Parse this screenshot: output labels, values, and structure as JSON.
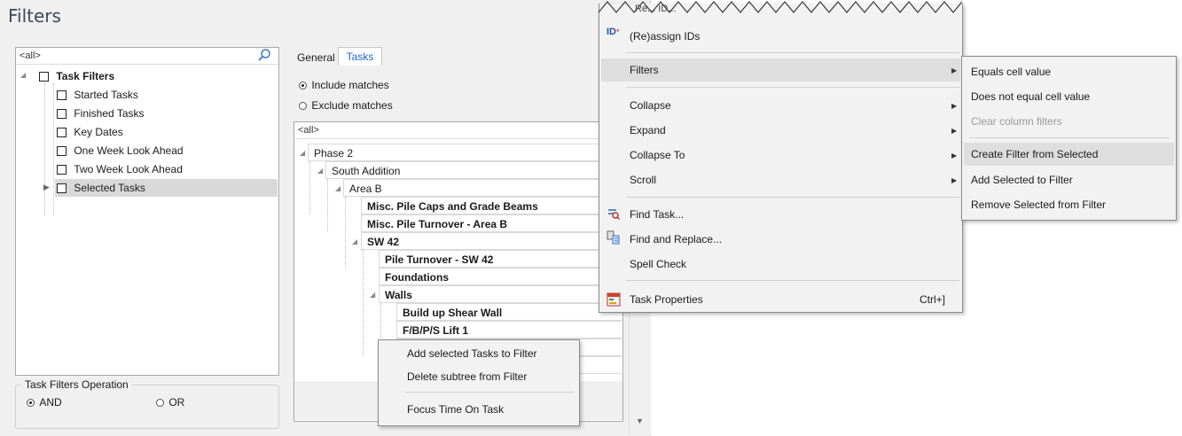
{
  "window": {
    "title": "Filters"
  },
  "left_panel": {
    "search_value": "<all>",
    "tree": {
      "root": "Task Filters",
      "items": [
        "Started Tasks",
        "Finished Tasks",
        "Key Dates",
        "One Week Look Ahead",
        "Two Week Look Ahead",
        "Selected Tasks"
      ]
    },
    "operation": {
      "label": "Task Filters Operation",
      "and": "AND",
      "or": "OR",
      "selected": "AND"
    }
  },
  "right_panel": {
    "tabs": [
      "General",
      "Tasks"
    ],
    "active_tab": "Tasks",
    "include": "Include matches",
    "exclude": "Exclude matches",
    "selected_option": "Include matches",
    "search_value": "<all>",
    "task_tree": [
      "Phase 2",
      "South Addition",
      "Area B",
      "Misc. Pile Caps and Grade Beams",
      "Misc. Pile Turnover - Area B",
      "SW 42",
      "Pile Turnover - SW 42",
      "Foundations",
      "Walls",
      "Build up Shear Wall",
      "F/B/P/S Lift 1"
    ]
  },
  "tree_context_menu": {
    "items": [
      "Add selected Tasks to Filter",
      "Delete subtree from Filter",
      "Focus Time On Task"
    ]
  },
  "context_menu": {
    "partial_top": "Re... ID...",
    "reassign": "(Re)assign IDs",
    "filters": "Filters",
    "collapse": "Collapse",
    "expand": "Expand",
    "collapse_to": "Collapse To",
    "scroll": "Scroll",
    "find_task": "Find Task...",
    "find_replace": "Find and Replace...",
    "spell_check": "Spell Check",
    "task_properties": "Task Properties",
    "task_properties_shortcut": "Ctrl+]"
  },
  "filters_submenu": {
    "equals": "Equals cell value",
    "not_equals": "Does not equal cell value",
    "clear": "Clear column filters",
    "create": "Create Filter from Selected",
    "add": "Add Selected to Filter",
    "remove": "Remove Selected from Filter"
  },
  "colors": {
    "accent": "#3c78c8",
    "highlight": "#dedede",
    "selected_row": "#d9d9d9"
  }
}
